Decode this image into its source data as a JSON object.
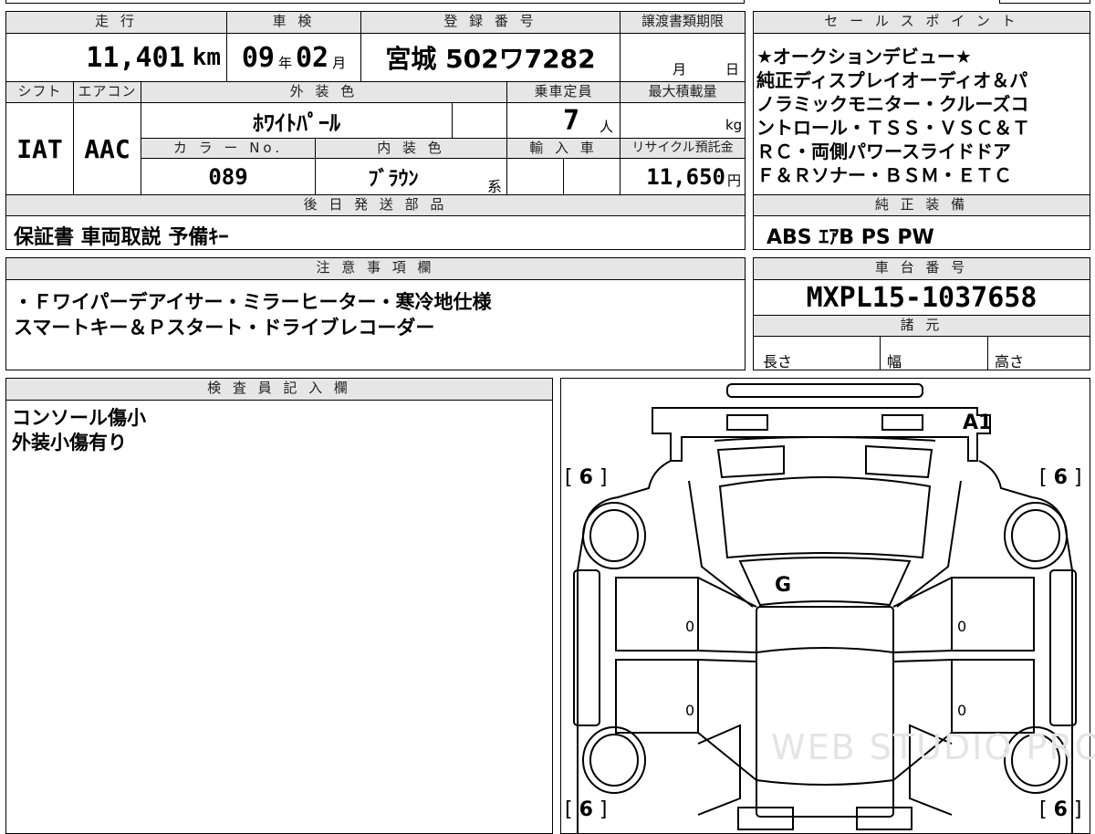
{
  "header": {
    "mileage_label": "走 行",
    "mileage": "11,401",
    "mileage_unit": "km",
    "inspection_label": "車 検",
    "inspection_year": "09",
    "inspection_year_unit": "年",
    "inspection_month": "02",
    "inspection_month_unit": "月",
    "plate_label": "登 録 番 号",
    "plate": "宮城 502ワ7282",
    "transfer_label": "譲渡書類期限",
    "transfer_month_unit": "月",
    "transfer_day_unit": "日"
  },
  "specs": {
    "shift_label": "シフト",
    "shift": "IAT",
    "aircon_label": "エアコン",
    "aircon": "AAC",
    "exterior_color_label": "外 装 色",
    "exterior_color": "ﾎﾜｲﾄﾊﾟｰﾙ",
    "capacity_label": "乗車定員",
    "capacity": "7",
    "capacity_unit": "人",
    "max_load_label": "最大積載量",
    "max_load_unit": "kg",
    "color_no_label": "カ ラ ー No.",
    "color_no": "089",
    "interior_color_label": "内 装 色",
    "interior_color": "ﾌﾞﾗｳﾝ",
    "interior_color_suffix": "系",
    "import_label": "輸 入 車",
    "recycle_label": "リサイクル預託金",
    "recycle_fee": "11,650",
    "recycle_unit": "円"
  },
  "later_parts": {
    "label": "後 日 発 送 部 品",
    "value": "保証書 車両取説 予備ｷｰ"
  },
  "notes": {
    "label": "注 意 事 項 欄",
    "line1": "・Ｆワイパーデアイサー・ミラーヒーター・寒冷地仕様",
    "line2": "スマートキー＆Ｐスタート・ドライブレコーダー"
  },
  "sales_points": {
    "label": "セ ー ル ス ポ イ ン ト",
    "lines": [
      "★オークションデビュー★",
      "純正ディスプレイオーディオ＆パ",
      "ノラミックモニター・クルーズコ",
      "ントロール・ＴＳＳ・ＶＳＣ＆Ｔ",
      "ＲＣ・両側パワースライドドア",
      "Ｆ＆Ｒソナー・ＢＳＭ・ＥＴＣ"
    ]
  },
  "equipment": {
    "label": "純 正 装 備",
    "value": "ABS ｴｱB PS PW"
  },
  "chassis": {
    "label": "車 台 番 号",
    "value": "MXPL15-1037658"
  },
  "dimensions": {
    "label": "諸 元",
    "length_label": "長さ",
    "width_label": "幅",
    "height_label": "高さ"
  },
  "inspector": {
    "label": "検 査 員 記 入 欄",
    "line1": "コンソール傷小",
    "line2": "外装小傷有り"
  },
  "diagram": {
    "mark_a1": "A1",
    "mark_g": "G",
    "tire_fl": "6",
    "tire_fr": "6",
    "tire_rl": "6",
    "tire_rr": "6",
    "door_fl": "0",
    "door_fr": "0",
    "door_rl": "0",
    "door_rr": "0",
    "watermark": "WEB STUDIO PRO"
  }
}
